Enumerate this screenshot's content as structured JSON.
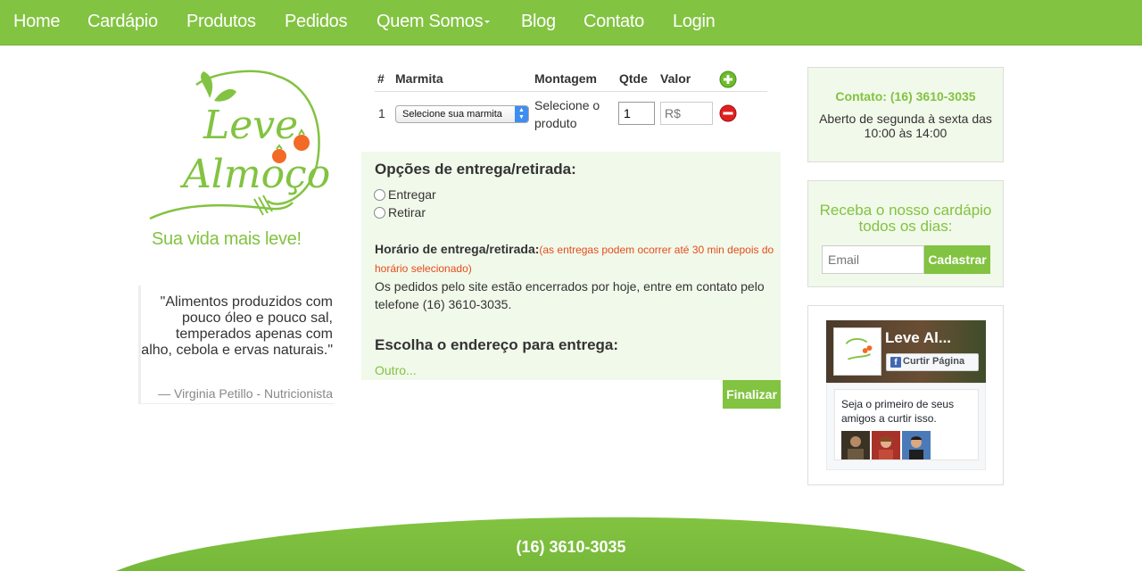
{
  "nav": {
    "items": [
      "Home",
      "Cardápio",
      "Produtos",
      "Pedidos",
      "Quem Somos",
      "Blog",
      "Contato",
      "Login"
    ]
  },
  "brand": {
    "logo_text_line1": "Leve",
    "logo_text_line2": "Almoço",
    "tagline": "Sua vida mais leve!"
  },
  "quote": {
    "text": "\"Alimentos produzidos com pouco óleo e pouco sal, temperados apenas com alho, cebola e ervas naturais.\"",
    "author": "— Virginia Petillo - Nutricionista"
  },
  "order_table": {
    "headers": [
      "#",
      "Marmita",
      "Montagem",
      "Qtde",
      "Valor"
    ],
    "rows": [
      {
        "num": "1",
        "marmita": "Selecione sua marmita",
        "montagem": "Selecione o produto",
        "qtde": "1",
        "valor_placeholder": "R$"
      }
    ]
  },
  "delivery": {
    "options_title": "Opções de entrega/retirada:",
    "options": [
      "Entregar",
      "Retirar"
    ],
    "schedule_label": "Horário de entrega/retirada:",
    "schedule_note": "(as entregas podem ocorrer até 30 min depois do horário selecionado)",
    "closed_message": "Os pedidos pelo site estão encerrados por hoje, entre em contato pelo telefone (16) 3610-3035.",
    "address_title": "Escolha o endereço para entrega:",
    "other_link": "Outro...",
    "submit_label": "Finalizar"
  },
  "contact_box": {
    "title": "Contato: (16) 3610-3035",
    "hours": "Aberto de segunda à sexta das 10:00 às 14:00"
  },
  "newsletter": {
    "title": "Receba o nosso cardápio todos os dias:",
    "email_placeholder": "Email",
    "button_label": "Cadastrar"
  },
  "facebook": {
    "page_name": "Leve Al...",
    "like_label": "Curtir Página",
    "friends_text": "Seja o primeiro de seus amigos a curtir isso."
  },
  "footer": {
    "phone": "(16) 3610-3035"
  },
  "colors": {
    "brand_green": "#82c341",
    "panel_bg": "#f1f9ea",
    "note_orange": "#e64c1a"
  }
}
